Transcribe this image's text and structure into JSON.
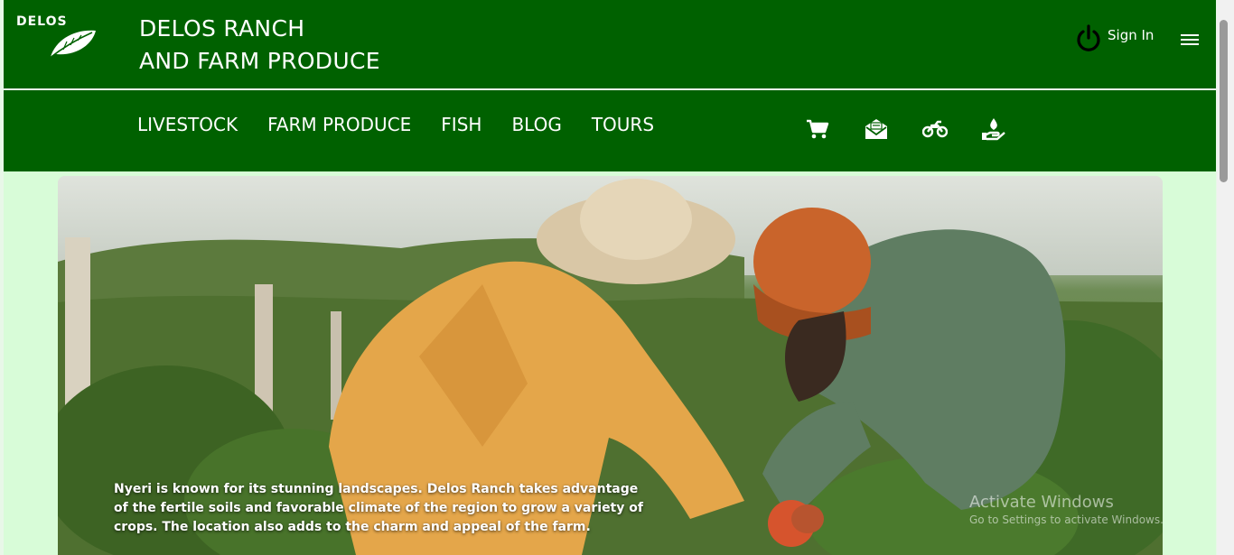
{
  "header": {
    "logo_text": "DELOS",
    "brand_line1": "DELOS RANCH",
    "brand_line2": "AND FARM PRODUCE",
    "signin_label": "Sign In"
  },
  "nav": {
    "links": [
      "LIVESTOCK",
      "FARM PRODUCE",
      "FISH",
      "BLOG",
      "TOURS"
    ],
    "icons": [
      "cart-icon",
      "mail-icon",
      "motorbike-icon",
      "hand-drop-icon"
    ]
  },
  "hero": {
    "caption": "Nyeri is known for its stunning landscapes. Delos Ranch takes advantage of the fertile soils and favorable climate of the region to grow a variety of crops. The location also adds to the charm and appeal of the farm."
  },
  "watermark": {
    "title": "Activate Windows",
    "subtitle": "Go to Settings to activate Windows."
  },
  "colors": {
    "header_green": "#006100",
    "page_background": "#d8fcd8"
  }
}
